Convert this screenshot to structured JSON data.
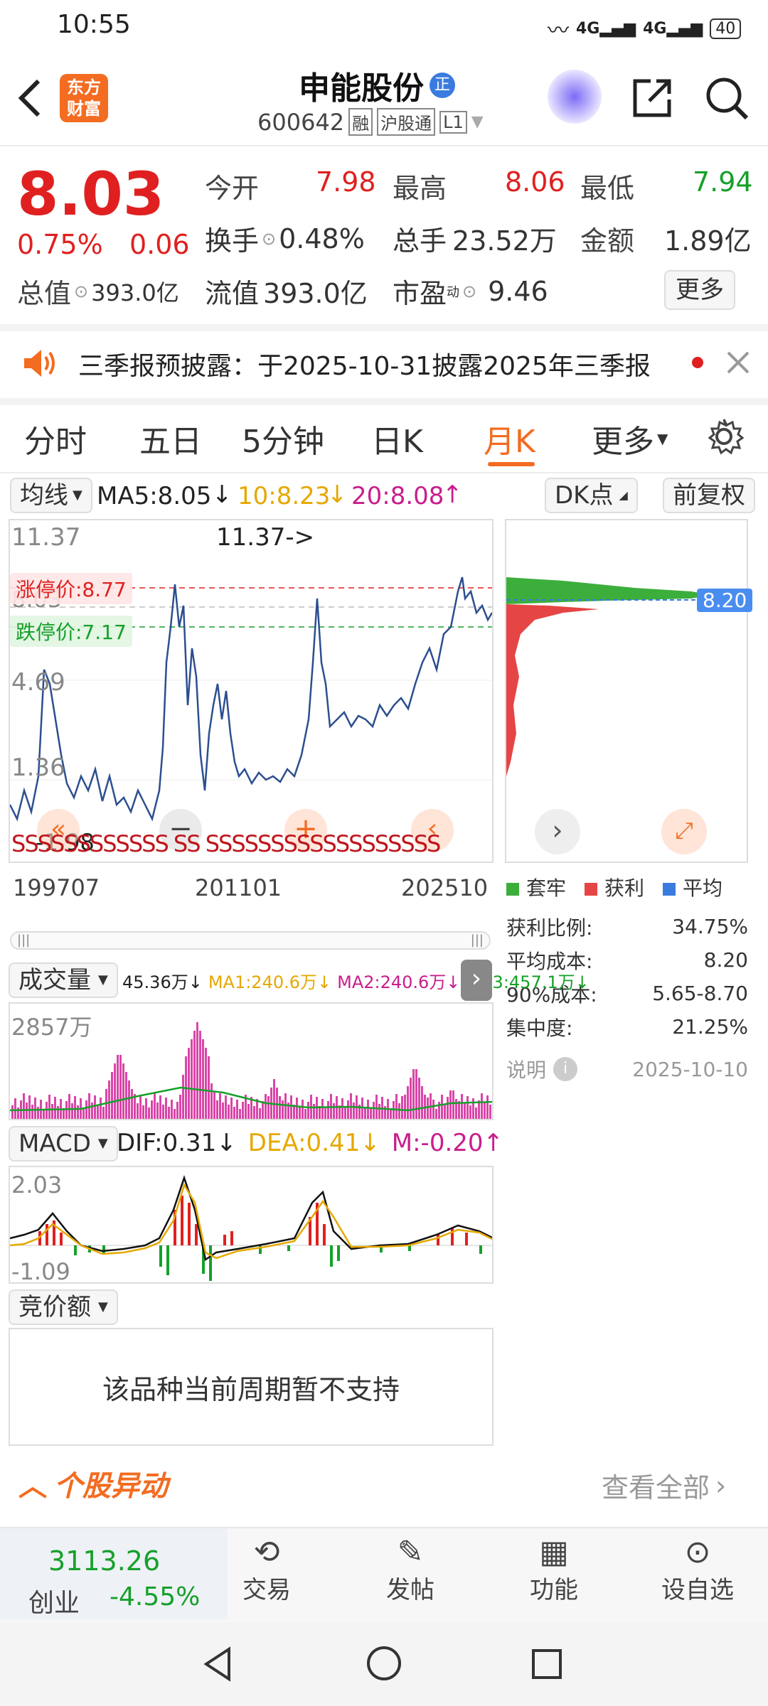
{
  "status_bar": {
    "time": "10:55",
    "network": "4G",
    "battery": "40"
  },
  "header": {
    "stock_name": "申能股份",
    "badge": "正",
    "code": "600642",
    "tags": [
      "融",
      "沪股通",
      "L1"
    ],
    "logo_line1": "东方",
    "logo_line2": "财富"
  },
  "quote": {
    "price": "8.03",
    "change_pct": "0.75%",
    "change": "0.06",
    "open_label": "今开",
    "open": "7.98",
    "high_label": "最高",
    "high": "8.06",
    "low_label": "最低",
    "low": "7.94",
    "turnover_label": "换手",
    "turnover": "0.48%",
    "volume_label": "总手",
    "volume": "23.52万",
    "amount_label": "金额",
    "amount": "1.89亿",
    "total_cap_label": "总值",
    "total_cap": "393.0亿",
    "float_cap_label": "流值",
    "float_cap": "393.0亿",
    "pe_label": "市盈",
    "pe_sup": "动",
    "pe": "9.46",
    "more": "更多"
  },
  "notice": {
    "text": "三季报预披露：于2025-10-31披露2025年三季报"
  },
  "tabs": [
    "分时",
    "五日",
    "5分钟",
    "日K",
    "月K",
    "更多"
  ],
  "active_tab": "月K",
  "ma_bar": {
    "select": "均线",
    "ma5": "MA5:8.05",
    "ma10": "10:8.23",
    "ma20": "20:8.08",
    "dk": "DK点",
    "fq": "前复权"
  },
  "main_chart": {
    "y_labels": [
      "11.37",
      "8.03",
      "4.69",
      "1.36",
      "-1.98"
    ],
    "max_note": "11.37->",
    "limit_up": "涨停价:8.77",
    "limit_down": "跌停价:7.17",
    "s_marks": "SSSSSSSSSSSS SS SSSSSSSSSSSSSSSSSS",
    "x_labels": [
      "199707",
      "201101",
      "202510"
    ],
    "colors": {
      "line": "#2c4f8f",
      "limit_up": "#e02020",
      "limit_down": "#16a02a"
    }
  },
  "chip_panel": {
    "avg_label": "8.20",
    "legend": [
      "套牢",
      "获利",
      "平均"
    ],
    "stats": [
      {
        "label": "获利比例:",
        "value": "34.75%"
      },
      {
        "label": "平均成本:",
        "value": "8.20"
      },
      {
        "label": "90%成本:",
        "value": "5.65-8.70"
      },
      {
        "label": "集中度:",
        "value": "21.25%"
      }
    ],
    "note_label": "说明",
    "date": "2025-10-10"
  },
  "volume": {
    "select": "成交量",
    "vol": "45.36万↓",
    "ma1": "MA1:240.6万↓",
    "ma2": "MA2:240.6万↓",
    "ma3": "MA3:457.1万↓",
    "top": "2857万"
  },
  "macd": {
    "select": "MACD",
    "dif": "DIF:0.31↓",
    "dea": "DEA:0.41↓",
    "m": "M:-0.20↑",
    "top": "2.03",
    "bottom": "-1.09"
  },
  "auction": {
    "select": "竞价额",
    "message": "该品种当前周期暂不支持"
  },
  "movement": {
    "title": "个股异动",
    "view_all": "查看全部"
  },
  "bottom_nav": {
    "index_value": "3113.26",
    "index_name": "创业",
    "index_change": "-4.55%",
    "items": [
      "交易",
      "发帖",
      "功能",
      "设自选"
    ]
  }
}
